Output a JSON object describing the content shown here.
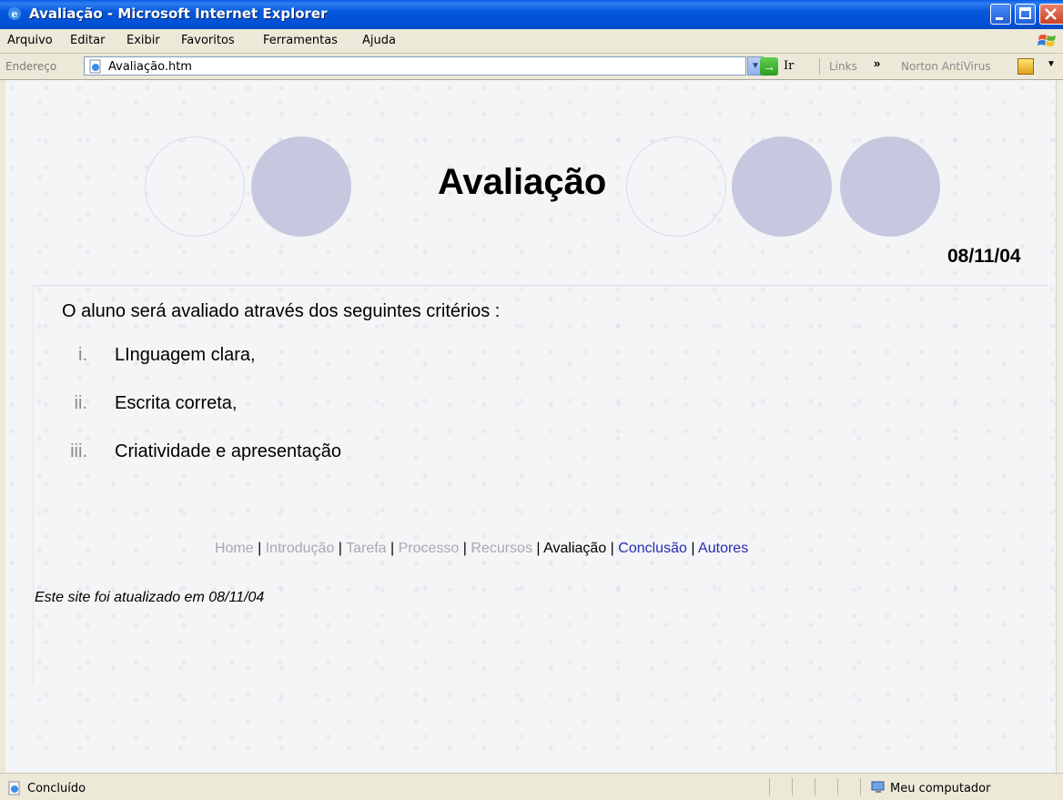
{
  "window": {
    "title": "Avaliação - Microsoft Internet Explorer"
  },
  "menu": [
    "Arquivo",
    "Editar",
    "Exibir",
    "Favoritos",
    "Ferramentas",
    "Ajuda"
  ],
  "address": {
    "label": "Endereço",
    "url": "Avaliação.htm",
    "go_label": "Ir",
    "links_label": "Links",
    "chevron": "»",
    "norton_label": "Norton AntiVirus"
  },
  "page": {
    "title": "Avaliação",
    "date": "08/11/04",
    "intro": "O aluno será avaliado através dos seguintes critérios :",
    "criteria": [
      {
        "num": "i.",
        "text": "LInguagem clara,"
      },
      {
        "num": "ii.",
        "text": "Escrita correta,"
      },
      {
        "num": "iii.",
        "text": "Criatividade e apresentação"
      }
    ],
    "nav": {
      "home": "Home",
      "introducao": "Introdução",
      "tarefa": "Tarefa",
      "processo": "Processo",
      "recursos": "Recursos",
      "avaliacao": "Avaliação",
      "conclusao": "Conclusão",
      "autores": "Autores",
      "separator": " | "
    },
    "footer_note": "Este site foi atualizado em 08/11/04"
  },
  "status": {
    "text": "Concluído",
    "zone": "Meu computador"
  },
  "icons": {
    "window": "ie-icon",
    "address_page": "ie-page-icon",
    "go": "go-arrow-icon",
    "norton": "norton-icon",
    "status": "ie-page-icon",
    "zone": "my-computer-icon"
  }
}
